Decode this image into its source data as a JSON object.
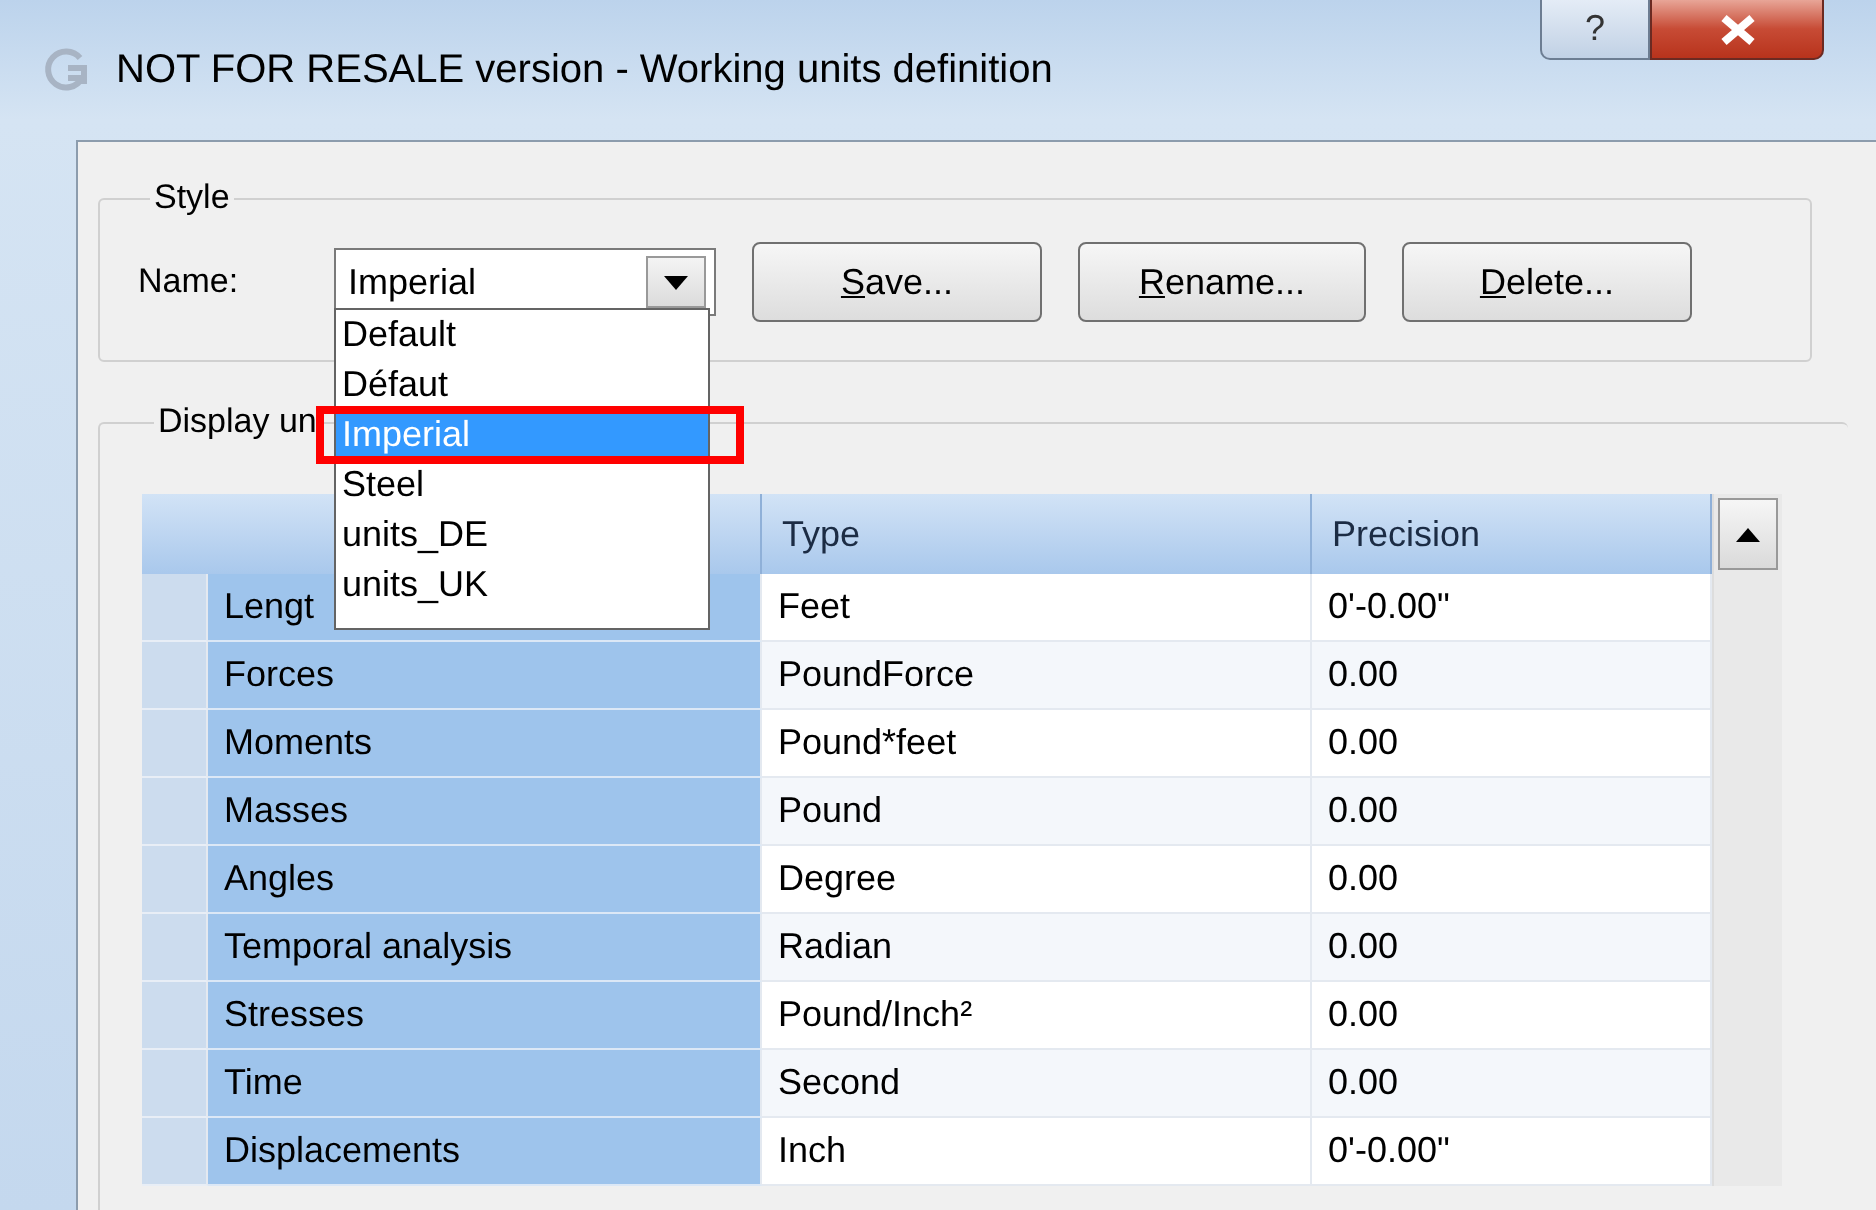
{
  "window": {
    "title": "NOT FOR RESALE version - Working units definition",
    "help_button": "?"
  },
  "style_group": {
    "title": "Style",
    "name_label": "Name:",
    "combo_value": "Imperial",
    "buttons": [
      {
        "label": "Save..."
      },
      {
        "label": "Rename..."
      },
      {
        "label": "Delete..."
      }
    ]
  },
  "dropdown": {
    "highlight_frame": true,
    "items": [
      {
        "label": "Default",
        "selected": false
      },
      {
        "label": "Défaut",
        "selected": false
      },
      {
        "label": "Imperial",
        "selected": true
      },
      {
        "label": "Steel",
        "selected": false
      },
      {
        "label": "units_DE",
        "selected": false
      },
      {
        "label": "units_UK",
        "selected": false
      }
    ]
  },
  "units_group": {
    "title": "Display un",
    "table": {
      "columns": [
        "Type",
        "Precision"
      ],
      "rows": [
        {
          "name": "Lengt",
          "type": "Feet",
          "precision": "0'-0.00\""
        },
        {
          "name": "Forces",
          "type": "PoundForce",
          "precision": "0.00"
        },
        {
          "name": "Moments",
          "type": "Pound*feet",
          "precision": "0.00"
        },
        {
          "name": "Masses",
          "type": "Pound",
          "precision": "0.00"
        },
        {
          "name": "Angles",
          "type": "Degree",
          "precision": "0.00"
        },
        {
          "name": "Temporal analysis",
          "type": "Radian",
          "precision": "0.00"
        },
        {
          "name": "Stresses",
          "type": "Pound/Inch²",
          "precision": "0.00"
        },
        {
          "name": "Time",
          "type": "Second",
          "precision": "0.00"
        },
        {
          "name": "Displacements",
          "type": "Inch",
          "precision": "0'-0.00\""
        }
      ]
    }
  }
}
